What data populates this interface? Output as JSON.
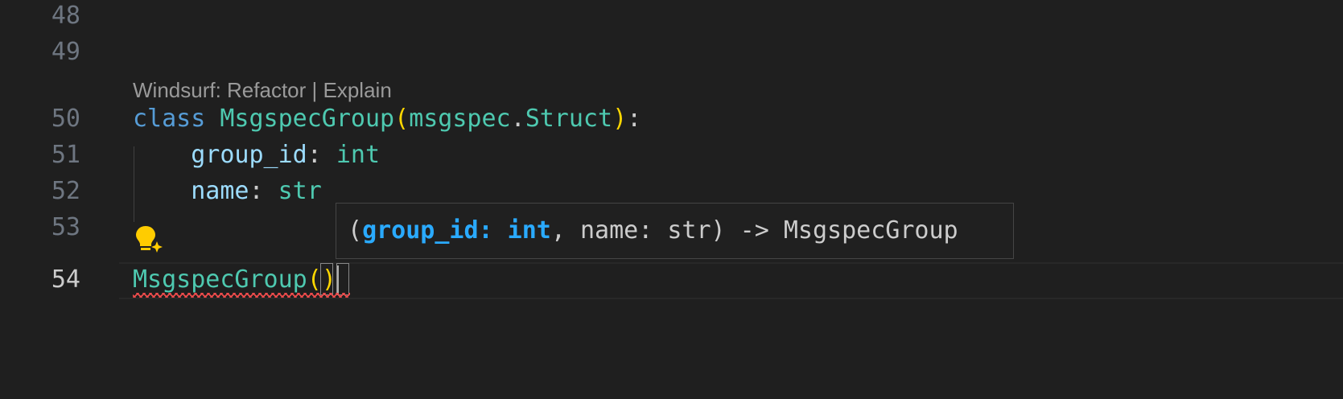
{
  "editor": {
    "line_numbers": [
      "48",
      "49",
      "50",
      "51",
      "52",
      "53",
      "54"
    ],
    "codelens": {
      "prefix": "Windsurf: ",
      "refactor": "Refactor",
      "separator": " | ",
      "explain": "Explain"
    },
    "line50": {
      "kw": "class",
      "name": "MsgspecGroup",
      "open": "(",
      "module": "msgspec",
      "dot": ".",
      "base": "Struct",
      "close": ")",
      "colon": ":"
    },
    "line51": {
      "field": "group_id",
      "colon": ": ",
      "type": "int"
    },
    "line52": {
      "field": "name",
      "colon": ": ",
      "type": "str"
    },
    "line54": {
      "call": "MsgspecGroup",
      "open": "(",
      "close": ")"
    },
    "lightbulb_icon": "lightbulb-sparkle-icon"
  },
  "signature_help": {
    "open": "(",
    "active_param": "group_id: int",
    "rest": ", name: str) -> MsgspecGroup"
  },
  "colors": {
    "background": "#1f1f1f",
    "keyword": "#569cd6",
    "class": "#4ec9b0",
    "variable": "#9cdcfe",
    "bracket": "#ffd700",
    "active_param": "#2aaaff",
    "error_squiggle": "#f14c4c"
  }
}
